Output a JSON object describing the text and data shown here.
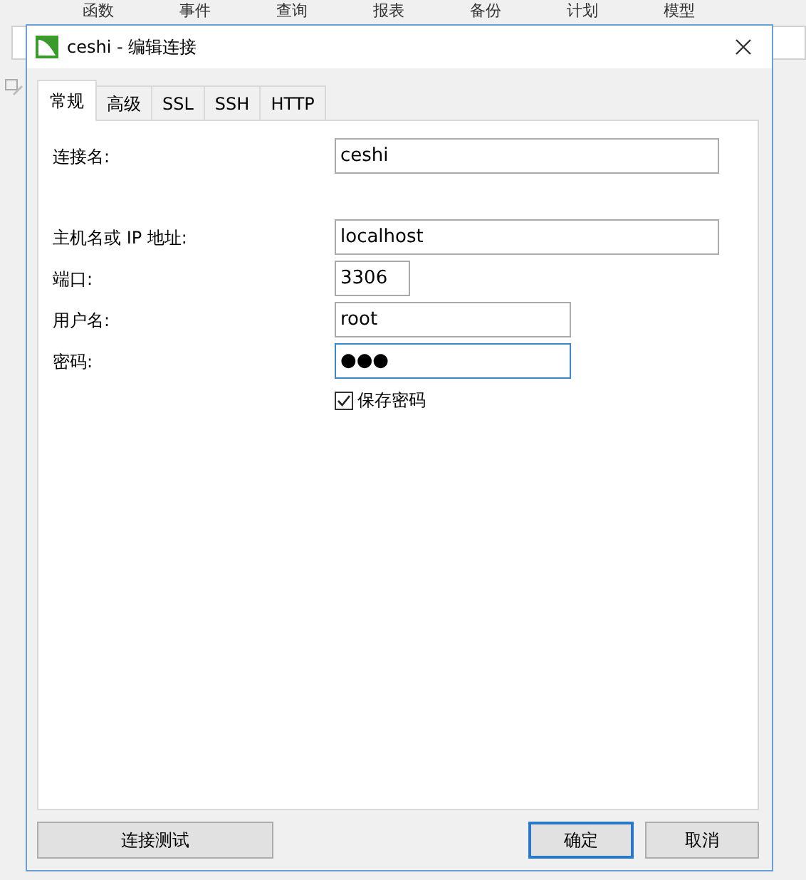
{
  "app_menu": [
    "函数",
    "事件",
    "查询",
    "报表",
    "备份",
    "计划",
    "模型"
  ],
  "dialog": {
    "title": "ceshi - 编辑连接",
    "tabs": [
      {
        "label": "常规",
        "selected": true
      },
      {
        "label": "高级",
        "selected": false
      },
      {
        "label": "SSL",
        "selected": false
      },
      {
        "label": "SSH",
        "selected": false
      },
      {
        "label": "HTTP",
        "selected": false
      }
    ],
    "sections": [
      [
        {
          "label": "连接名:",
          "value": "ceshi",
          "focused": false
        }
      ],
      [
        {
          "label": "主机名或 IP 地址:",
          "value": "localhost",
          "focused": false
        },
        {
          "label": "端口:",
          "value": "3306",
          "focused": false
        },
        {
          "label": "用户名:",
          "value": "root",
          "focused": false
        },
        {
          "label": "密码:",
          "value": "●●●",
          "focused": true
        }
      ]
    ],
    "save_password": {
      "label": "保存密码",
      "checked": true
    },
    "buttons": [
      {
        "label": "连接测试",
        "default": false
      },
      {
        "label": "确定",
        "default": true
      },
      {
        "label": "取消",
        "default": false
      }
    ]
  }
}
